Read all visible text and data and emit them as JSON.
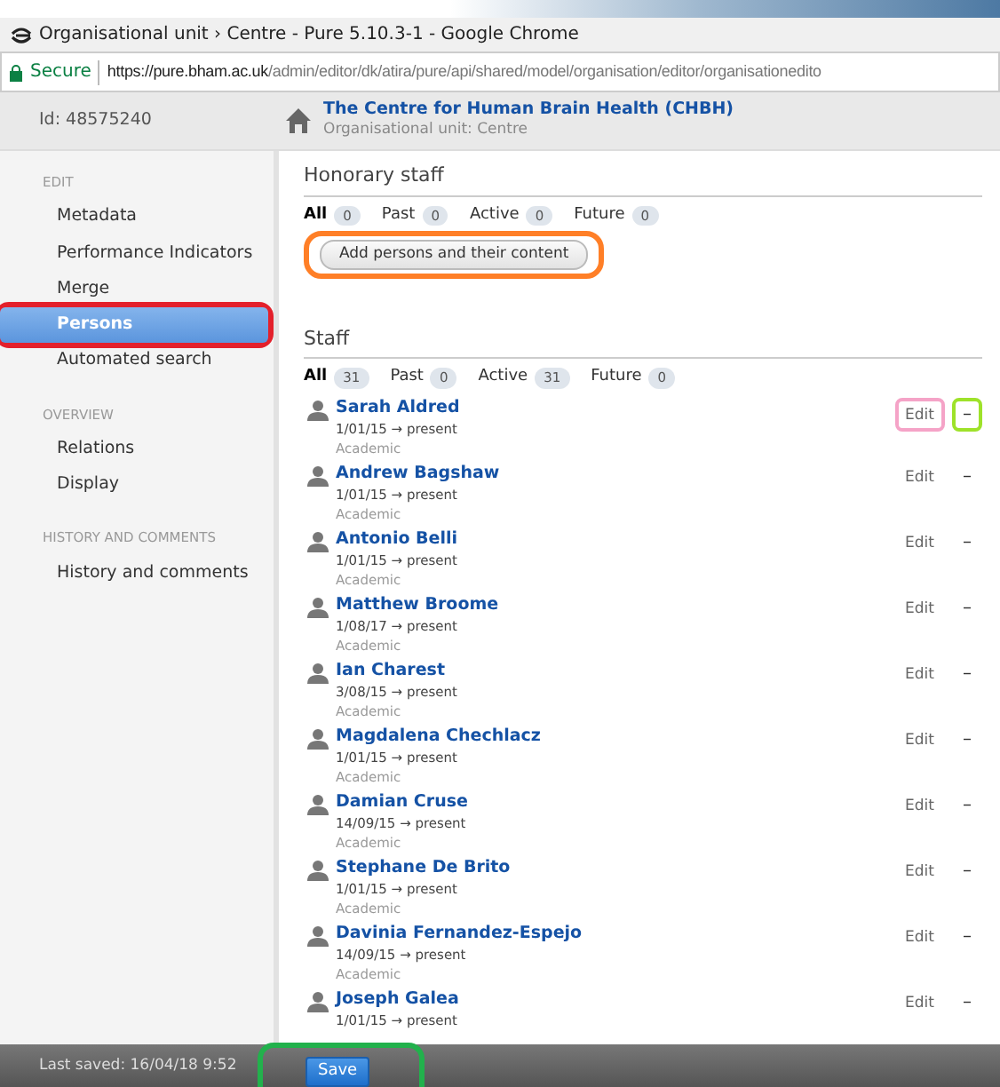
{
  "window": {
    "title": "Organisational unit › Centre - Pure 5.10.3-1 - Google Chrome"
  },
  "address_bar": {
    "security": "Secure",
    "url_host": "https://pure.bham.ac.uk",
    "url_path": "/admin/editor/dk/atira/pure/api/shared/model/organisation/editor/organisationedito"
  },
  "header": {
    "id": "Id: 48575240",
    "title": "The Centre for Human Brain Health (CHBH)",
    "subtitle": "Organisational unit: Centre"
  },
  "sidebar": {
    "sections": [
      {
        "heading": "EDIT",
        "items": [
          {
            "label": "Metadata",
            "selected": false
          },
          {
            "label": "Performance Indicators",
            "selected": false
          },
          {
            "label": "Merge",
            "selected": false
          },
          {
            "label": "Persons",
            "selected": true,
            "color": "#e3202b"
          },
          {
            "label": "Automated search",
            "selected": false
          }
        ]
      },
      {
        "heading": "OVERVIEW",
        "items": [
          {
            "label": "Relations",
            "selected": false
          },
          {
            "label": "Display",
            "selected": false
          }
        ]
      },
      {
        "heading": "HISTORY AND COMMENTS",
        "items": [
          {
            "label": "History and comments",
            "selected": false
          }
        ]
      }
    ]
  },
  "honorary_staff": {
    "title": "Honorary staff",
    "filters": [
      {
        "label": "All",
        "count": "0",
        "selected": true
      },
      {
        "label": "Past",
        "count": "0",
        "selected": false
      },
      {
        "label": "Active",
        "count": "0",
        "selected": false
      },
      {
        "label": "Future",
        "count": "0",
        "selected": false
      }
    ],
    "add_button": {
      "label": "Add persons and their content",
      "color": "#ff7f27"
    }
  },
  "staff": {
    "title": "Staff",
    "filters": [
      {
        "label": "All",
        "count": "31",
        "selected": true
      },
      {
        "label": "Past",
        "count": "0",
        "selected": false
      },
      {
        "label": "Active",
        "count": "31",
        "selected": false
      },
      {
        "label": "Future",
        "count": "0",
        "selected": false
      }
    ],
    "persons": [
      {
        "name": "Sarah Aldred",
        "period": "1/01/15 → present",
        "role": "Academic",
        "edit": "Edit",
        "remove": "–",
        "edit_ring": {
          "color": "#f5a3c7"
        },
        "remove_ring": {
          "color": "#9ee22a"
        }
      },
      {
        "name": "Andrew Bagshaw",
        "period": "1/01/15 → present",
        "role": "Academic",
        "edit": "Edit",
        "remove": "–"
      },
      {
        "name": "Antonio Belli",
        "period": "1/01/15 → present",
        "role": "Academic",
        "edit": "Edit",
        "remove": "–"
      },
      {
        "name": "Matthew Broome",
        "period": "1/08/17 → present",
        "role": "Academic",
        "edit": "Edit",
        "remove": "–"
      },
      {
        "name": "Ian Charest",
        "period": "3/08/15 → present",
        "role": "Academic",
        "edit": "Edit",
        "remove": "–"
      },
      {
        "name": "Magdalena Chechlacz",
        "period": "1/01/15 → present",
        "role": "Academic",
        "edit": "Edit",
        "remove": "–"
      },
      {
        "name": "Damian Cruse",
        "period": "14/09/15 → present",
        "role": "Academic",
        "edit": "Edit",
        "remove": "–"
      },
      {
        "name": "Stephane De Brito",
        "period": "1/01/15 → present",
        "role": "Academic",
        "edit": "Edit",
        "remove": "–"
      },
      {
        "name": "Davinia Fernandez-Espejo",
        "period": "14/09/15 → present",
        "role": "Academic",
        "edit": "Edit",
        "remove": "–"
      },
      {
        "name": "Joseph Galea",
        "period": "1/01/15 → present",
        "edit": "Edit",
        "remove": "–"
      }
    ]
  },
  "footer": {
    "last_saved": "Last saved: 16/04/18 9:52",
    "save_button": {
      "label": "Save",
      "color": "#22b14c"
    }
  }
}
